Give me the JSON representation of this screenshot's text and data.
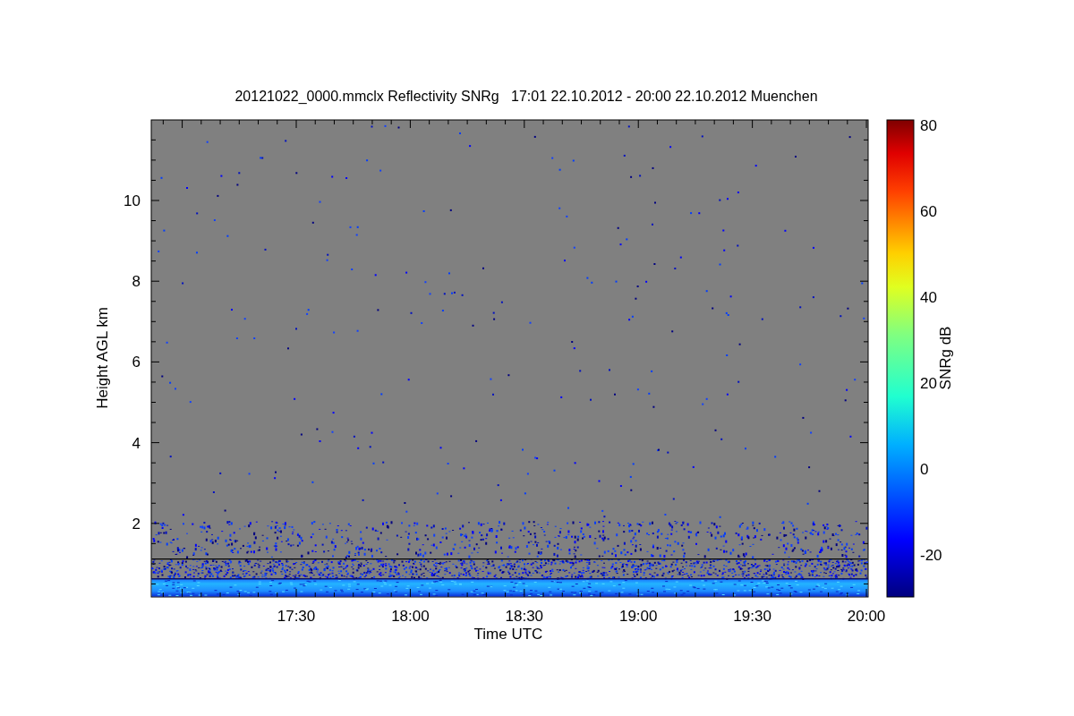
{
  "plot": {
    "title": "20121022_0000.mmclx Reflectivity SNRg   17:01 22.10.2012 - 20:00 22.10.2012 Muenchen",
    "xlabel": "Time UTC",
    "ylabel": "Height AGL km",
    "x_tick_labels": [
      "17:30",
      "18:00",
      "18:30",
      "19:00",
      "19:30",
      "20:00"
    ],
    "y_tick_labels": [
      "10",
      "8",
      "6",
      "4",
      "2"
    ],
    "colorbar": {
      "label": "SNRg dB",
      "tick_labels": [
        "80",
        "60",
        "40",
        "20",
        "0",
        "-20"
      ]
    }
  }
}
